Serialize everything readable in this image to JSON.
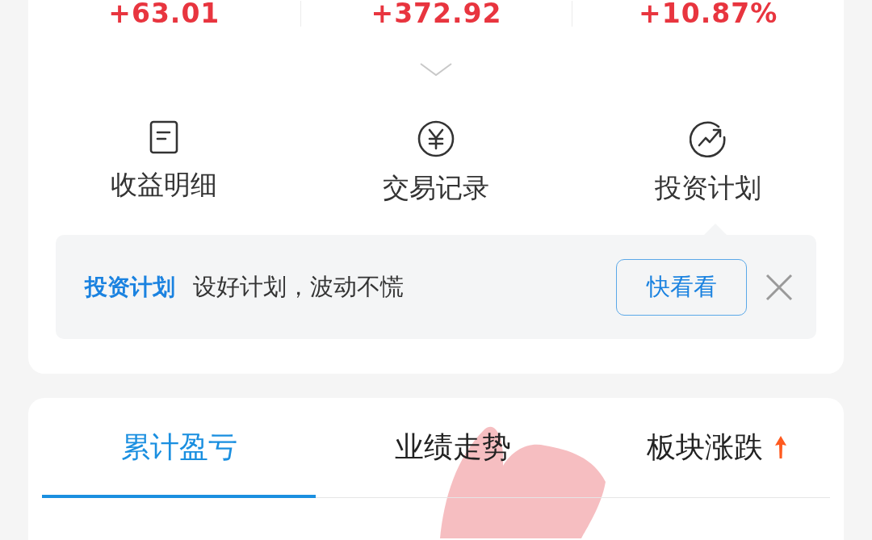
{
  "summary": {
    "values": [
      {
        "text": "+63.01"
      },
      {
        "text": "+372.92"
      },
      {
        "text": "+10.87%"
      }
    ],
    "expanded": false
  },
  "shortcuts": [
    {
      "label": "收益明细",
      "kind": "document"
    },
    {
      "label": "交易记录",
      "kind": "yen"
    },
    {
      "label": "投资计划",
      "kind": "trend"
    }
  ],
  "banner": {
    "title": "投资计划",
    "text": "设好计划，波动不慌",
    "button": "快看看"
  },
  "tabs": [
    {
      "label": "累计盈亏",
      "selected": true,
      "hot": false
    },
    {
      "label": "业绩走势",
      "selected": false,
      "hot": false
    },
    {
      "label": "板块涨跌",
      "selected": false,
      "hot": true
    }
  ]
}
